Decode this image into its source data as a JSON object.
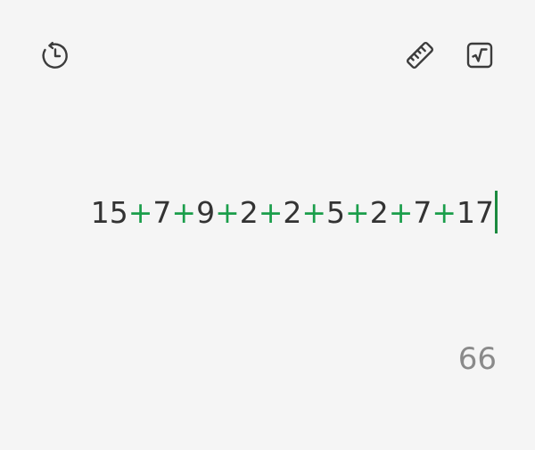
{
  "toolbar": {
    "history_icon": "history-icon",
    "unit_converter_icon": "ruler-icon",
    "scientific_icon": "square-root-icon"
  },
  "colors": {
    "background": "#f5f5f5",
    "operator": "#1b9e4b",
    "cursor": "#1b8a3f",
    "text": "#333333",
    "result": "#8a8a8a"
  },
  "expression": {
    "tokens": [
      {
        "type": "num",
        "text": "15"
      },
      {
        "type": "op",
        "text": "+"
      },
      {
        "type": "num",
        "text": "7"
      },
      {
        "type": "op",
        "text": "+"
      },
      {
        "type": "num",
        "text": "9"
      },
      {
        "type": "op",
        "text": "+"
      },
      {
        "type": "num",
        "text": "2"
      },
      {
        "type": "op",
        "text": "+"
      },
      {
        "type": "num",
        "text": "2"
      },
      {
        "type": "op",
        "text": "+"
      },
      {
        "type": "num",
        "text": "5"
      },
      {
        "type": "op",
        "text": "+"
      },
      {
        "type": "num",
        "text": "2"
      },
      {
        "type": "op",
        "text": "+"
      },
      {
        "type": "num",
        "text": "7"
      },
      {
        "type": "op",
        "text": "+"
      },
      {
        "type": "num",
        "text": "17"
      }
    ]
  },
  "result": {
    "value": "66"
  }
}
